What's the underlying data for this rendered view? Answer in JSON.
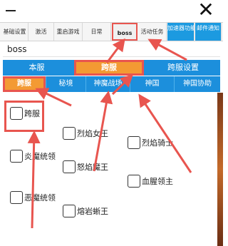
{
  "window": {
    "close_glyph": "✕"
  },
  "tabs": [
    {
      "label": "基础设置"
    },
    {
      "label": "激活"
    },
    {
      "label": "重启游戏"
    },
    {
      "label": "日常"
    },
    {
      "label": "boss",
      "active": true
    },
    {
      "label": "活动任务"
    },
    {
      "label": "加速器功能"
    },
    {
      "label": "邮件通知"
    }
  ],
  "search": {
    "value": "boss"
  },
  "server_tabs": [
    {
      "label": "本服"
    },
    {
      "label": "跨服",
      "active": true
    },
    {
      "label": "跨服设置"
    }
  ],
  "sub_tabs": [
    {
      "label": "跨服",
      "active": true
    },
    {
      "label": "秘境"
    },
    {
      "label": "神魔战场"
    },
    {
      "label": "神国"
    },
    {
      "label": "神国协助"
    }
  ],
  "bosses": [
    {
      "label": "跨服"
    },
    {
      "label": "烈焰女王"
    },
    {
      "label": "烈焰骑士"
    },
    {
      "label": "炎魔统领"
    },
    {
      "label": "怒焰魔王"
    },
    {
      "label": "血腥领主"
    },
    {
      "label": "恶魔统领"
    },
    {
      "label": "熔岩蜥王"
    }
  ],
  "colors": {
    "tab_blue": "#1c8fdc",
    "active_orange": "#f39a33",
    "annotation_red": "#e8554f"
  }
}
